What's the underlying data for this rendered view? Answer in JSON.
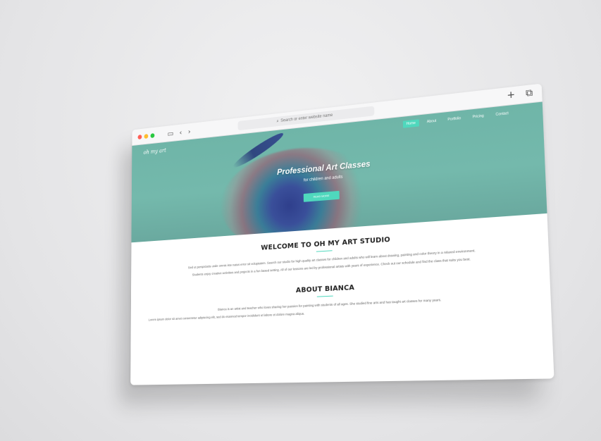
{
  "browser": {
    "address_placeholder": "Search or enter website name",
    "new_tab_label": "+",
    "tabs_icon": "tabs-icon",
    "sidebar_icon": "sidebar-icon",
    "back_icon": "chevron-left-icon",
    "forward_icon": "chevron-right-icon",
    "search_icon": "search-icon"
  },
  "site": {
    "logo": "oh my art",
    "nav": [
      {
        "label": "Home",
        "active": true
      },
      {
        "label": "About",
        "active": false
      },
      {
        "label": "Portfolio",
        "active": false
      },
      {
        "label": "Pricing",
        "active": false
      },
      {
        "label": "Contact",
        "active": false
      }
    ],
    "hero": {
      "title": "Professional Art Classes",
      "subtitle": "for children and adults",
      "button": "READ MORE"
    },
    "welcome": {
      "title": "WELCOME TO OH MY ART STUDIO",
      "paragraphs": [
        "Sed ut perspiciatis unde omnis iste natus error sit voluptatem. Search our studio for high quality art classes for children and adults who will learn about drawing, painting and color theory in a relaxed environment.",
        "Students enjoy creative activities and projects in a fun based setting. All of our lessons are led by professional artists with years of experience. Check out our schedule and find the class that suits you best."
      ]
    },
    "about": {
      "title": "ABOUT BIANCA",
      "paragraphs": [
        "Bianca is an artist and teacher who loves sharing her passion for painting with students of all ages. She studied fine arts and has taught art classes for many years.",
        "Lorem ipsum dolor sit amet consectetur adipiscing elit, sed do eiusmod tempor incididunt ut labore et dolore magna aliqua."
      ]
    }
  },
  "colors": {
    "accent": "#4fd8bd",
    "hero_bg": "#6fb5a8",
    "traffic_red": "#ff5f57",
    "traffic_yellow": "#febc2e",
    "traffic_green": "#28c840"
  }
}
